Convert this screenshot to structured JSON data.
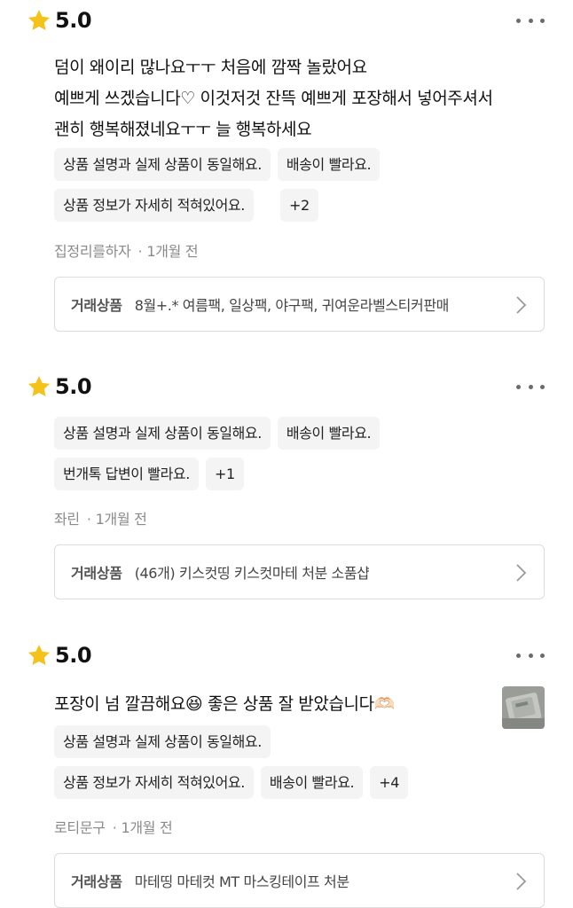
{
  "colors": {
    "star": "#F5C21B",
    "tag_bg": "#f4f4f4",
    "border": "#dcdcdc"
  },
  "icons": {
    "star": "star-icon",
    "more": "more-dots-icon",
    "chevron": "chevron-right-icon",
    "thumb": "photo-thumbnail"
  },
  "reviews": [
    {
      "rating": "5.0",
      "lines": [
        "덤이 왜이리 많나요ㅜㅜ 처음에 깜짝 놀랐어요",
        "예쁘게 쓰겠습니다♡ 이것저것 잔뜩 예쁘게 포장해서 넣어주셔서",
        "괜히 행복해졌네요ㅜㅜ 늘 행복하세요"
      ],
      "tags": [
        "상품 설명과 실제 상품이 동일해요.",
        "배송이 빨라요.",
        "상품 정보가 자세히 적혀있어요.",
        "+2"
      ],
      "user": "집정리를하자",
      "time": "1개월 전",
      "product_label": "거래상품",
      "product_name": "8월+.* 여름팩, 일상팩, 야구팩, 귀여운라벨스티커판매"
    },
    {
      "rating": "5.0",
      "lines": [],
      "tags": [
        "상품 설명과 실제 상품이 동일해요.",
        "배송이 빨라요.",
        "번개톡 답변이 빨라요.",
        "+1"
      ],
      "user": "좌린",
      "time": "1개월 전",
      "product_label": "거래상품",
      "product_name": "(46개) 키스컷띵 키스컷마테 처분 소품샵"
    },
    {
      "rating": "5.0",
      "lines": [
        "포장이 넘 깔끔해요😆 좋은 상품 잘 받았습니다🫶🏻"
      ],
      "tags": [
        "상품 설명과 실제 상품이 동일해요.",
        "상품 정보가 자세히 적혀있어요.",
        "배송이 빨라요.",
        "+4"
      ],
      "user": "로티문구",
      "time": "1개월 전",
      "product_label": "거래상품",
      "product_name": "마테띵 마테컷 MT 마스킹테이프 처분"
    }
  ]
}
